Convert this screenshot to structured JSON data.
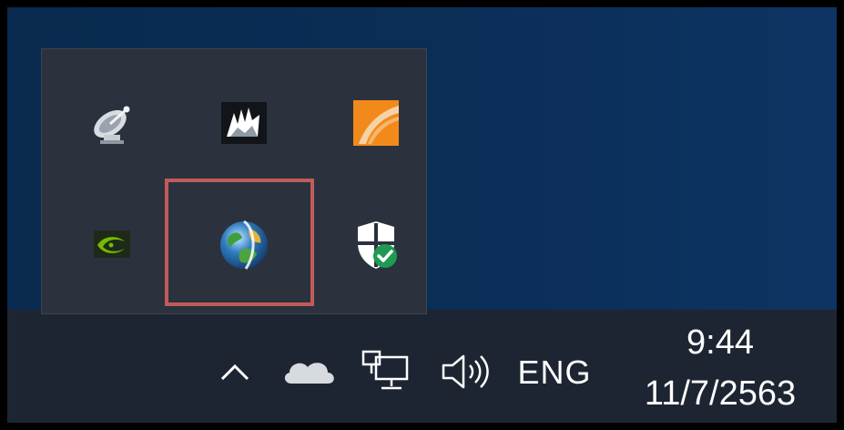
{
  "tray_flyout": {
    "icons": [
      {
        "name": "satellite-dish-icon",
        "label": ""
      },
      {
        "name": "corsair-icon",
        "label": ""
      },
      {
        "name": "orange-app-icon",
        "label": ""
      },
      {
        "name": "nvidia-icon",
        "label": ""
      },
      {
        "name": "globe-icon",
        "label": ""
      },
      {
        "name": "security-shield-icon",
        "label": ""
      }
    ],
    "highlight_color": "#c15b5b"
  },
  "taskbar": {
    "language": "ENG",
    "time": "9:44",
    "date": "11/7/2563",
    "icons": [
      "chevron-up-icon",
      "onedrive-icon",
      "network-icon",
      "volume-icon"
    ]
  },
  "colors": {
    "desktop": "#0b2e57",
    "taskbar": "#1e2532",
    "flyout": "#2b323d",
    "nvidia_green": "#76b900",
    "orange": "#f28a1b"
  }
}
